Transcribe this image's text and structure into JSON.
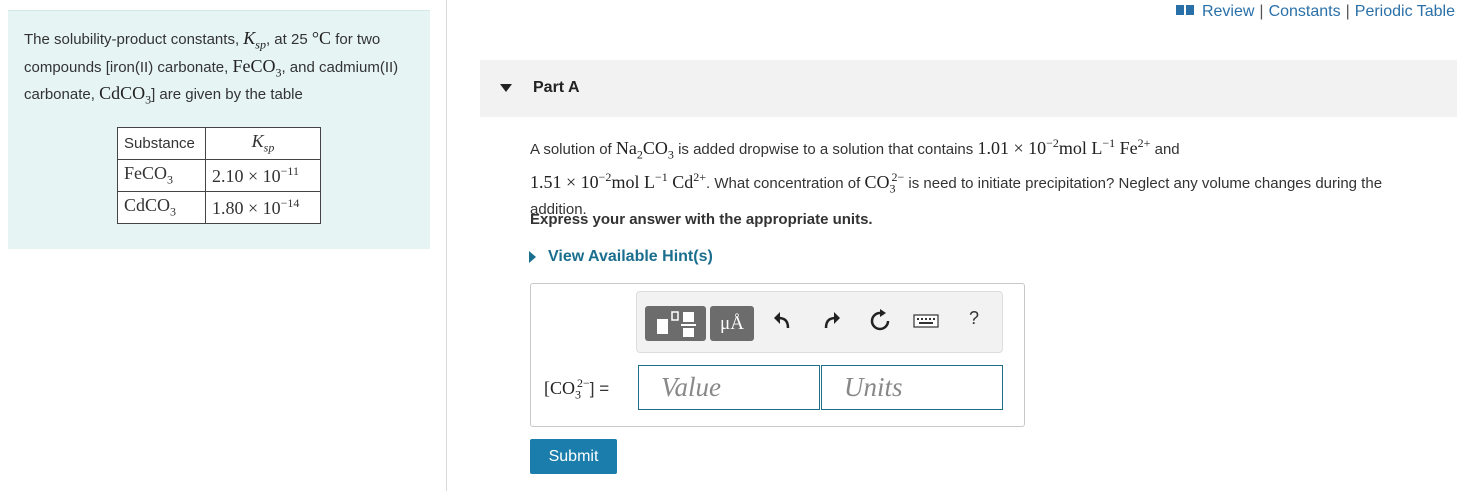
{
  "top_links": {
    "icon": "book-icon",
    "review": "Review",
    "constants": "Constants",
    "periodic_table": "Periodic Table",
    "separator": "|"
  },
  "info": {
    "intro_1": "The solubility-product constants, ",
    "ksp_symbol": "K",
    "ksp_sub": "sp",
    "intro_2": ", at 25 ",
    "temperature_unit": "°C",
    "intro_3": " for two compounds [iron(II) carbonate, ",
    "compound_1": "FeCO",
    "compound_1_sub": "3",
    "intro_4": ", and cadmium(II) carbonate, ",
    "compound_2": "CdCO",
    "compound_2_sub": "3",
    "intro_5": "] are given by the table",
    "table": {
      "header_substance": "Substance",
      "header_ksp": "K",
      "header_ksp_sub": "sp",
      "rows": [
        {
          "substance": "FeCO",
          "substance_sub": "3",
          "mantissa": "2.10 × 10",
          "exponent": "−11"
        },
        {
          "substance": "CdCO",
          "substance_sub": "3",
          "mantissa": "1.80 × 10",
          "exponent": "−14"
        }
      ]
    }
  },
  "part": {
    "title": "Part A"
  },
  "question": {
    "t1": "A solution of ",
    "na": "Na",
    "na_sub": "2",
    "na2": "CO",
    "na2_sub": "3",
    "t2": " is added dropwise to a solution that contains ",
    "c1": "1.01 × 10",
    "c1_exp": "−2",
    "c1_unit": "mol L",
    "c1_unit_exp": "−1",
    "ion1": "Fe",
    "ion1_charge": "2+",
    "t3": " and",
    "c2": "1.51 × 10",
    "c2_exp": "−2",
    "c2_unit": "mol L",
    "c2_unit_exp": "−1",
    "ion2": "Cd",
    "ion2_charge": "2+",
    "t4": ". What concentration of ",
    "co": "CO",
    "co_sub": "3",
    "co_charge": "2−",
    "t5": " is need to initiate precipitation? Neglect any volume changes during the addition."
  },
  "instruction": "Express your answer with the appropriate units.",
  "hint_link": "View Available Hint(s)",
  "toolbar": {
    "units_label": "μÅ",
    "help_label": "?"
  },
  "answer": {
    "label_open": "[CO",
    "label_sub": "3",
    "label_charge": "2−",
    "label_close": "] =",
    "value_placeholder": "Value",
    "units_placeholder": "Units"
  },
  "submit_label": "Submit"
}
